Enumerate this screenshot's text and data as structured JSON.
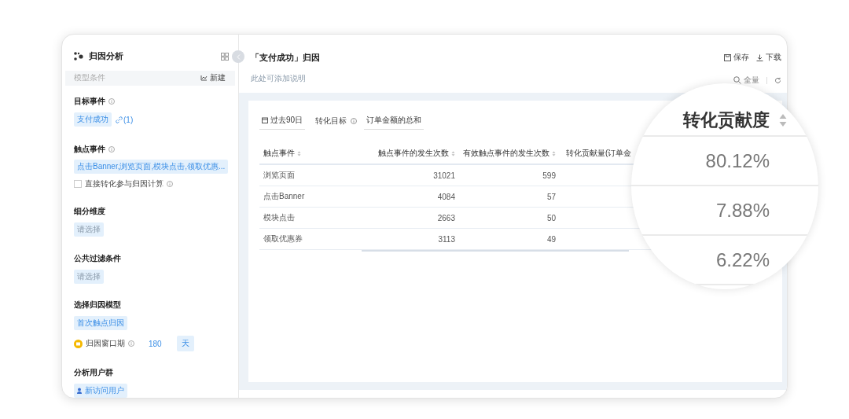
{
  "sidebar": {
    "title": "归因分析",
    "section_header": {
      "label": "模型条件",
      "action": "新建"
    },
    "target_event": {
      "title": "目标事件",
      "tag": "支付成功",
      "link_count": "(1)"
    },
    "touch_events": {
      "title": "触点事件",
      "tag": "点击Banner,浏览页面,模块点击,领取优惠...",
      "checkbox": {
        "label": "直接转化参与归因计算",
        "checked": false
      }
    },
    "breakdown": {
      "title": "细分维度",
      "placeholder": "请选择"
    },
    "filter": {
      "title": "公共过滤条件",
      "placeholder": "请选择"
    },
    "model": {
      "title": "选择归因模型",
      "tag": "首次触点归因",
      "window_label": "归因窗口期",
      "window_value": "180",
      "window_unit": "天"
    },
    "users": {
      "title": "分析用户群",
      "tag": "新访问用户"
    }
  },
  "main": {
    "title": "「支付成功」归因",
    "description": "此处可添加说明",
    "actions": [
      "保存",
      "下载"
    ],
    "scope": "全量",
    "toolbar": {
      "date": "过去90日",
      "target_label": "转化目标",
      "target_value": "订单金额的总和"
    },
    "table": {
      "columns": [
        "触点事件",
        "触点事件的发生次数",
        "有效触点事件的发生次数",
        "转化贡献量(订单金"
      ],
      "rows": [
        {
          "cells": [
            "浏览页面",
            "31021",
            "599"
          ]
        },
        {
          "cells": [
            "点击Banner",
            "4084",
            "57"
          ]
        },
        {
          "cells": [
            "模块点击",
            "2663",
            "50"
          ]
        },
        {
          "cells": [
            "领取优惠券",
            "3113",
            "49"
          ]
        }
      ]
    }
  },
  "magnifier": {
    "header": "转化贡献度",
    "values": [
      "80.12%",
      "7.88%",
      "6.22%"
    ]
  }
}
